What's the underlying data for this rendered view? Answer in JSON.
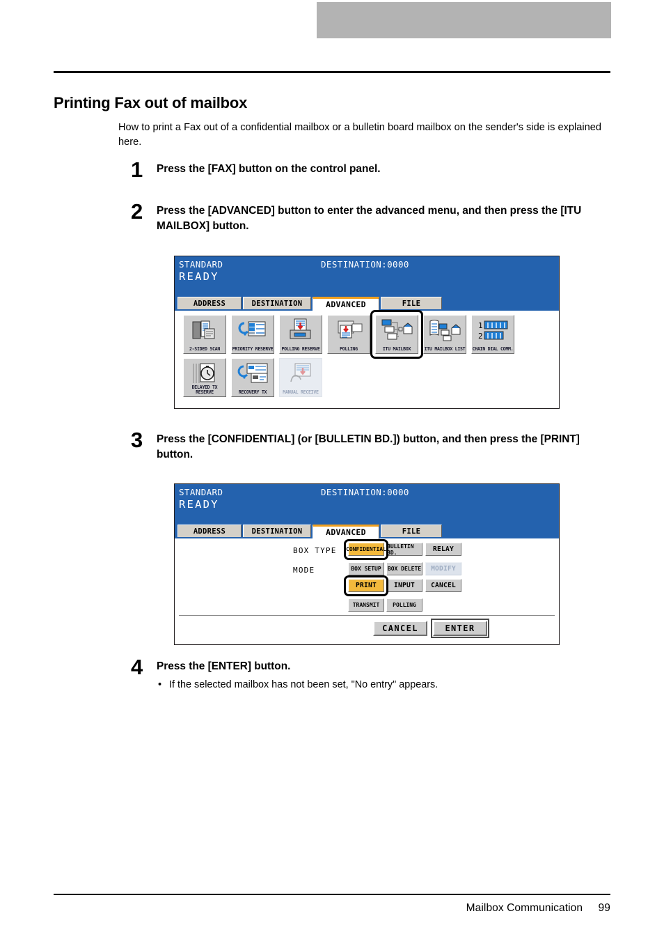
{
  "page": {
    "title": "Printing Fax out of mailbox",
    "intro": "How to print a Fax out of a confidential mailbox or a bulletin board mailbox on the sender's side is explained here.",
    "footer_section": "Mailbox Communication",
    "footer_page": "99"
  },
  "steps": [
    {
      "number": "1",
      "text": "Press the [FAX] button on the control panel."
    },
    {
      "number": "2",
      "text": "Press the [ADVANCED] button to enter the advanced menu, and then press the [ITU MAILBOX] button."
    },
    {
      "number": "3",
      "text": "Press the [CONFIDENTIAL] (or [BULLETIN BD.]) button, and then press the [PRINT] button."
    },
    {
      "number": "4",
      "text": "Press the [ENTER] button.",
      "bullet": "•",
      "note": "If the selected mailbox has not been set, \"No entry\" appears."
    }
  ],
  "panel_advanced": {
    "status_left": "STANDARD",
    "status_right": "DESTINATION:0000",
    "ready": "READY",
    "tabs": [
      {
        "label": "ADDRESS",
        "active": false
      },
      {
        "label": "DESTINATION",
        "active": false
      },
      {
        "label": "ADVANCED",
        "active": true
      },
      {
        "label": "FILE",
        "active": false
      }
    ],
    "row1": [
      {
        "label": "2-SIDED SCAN",
        "icon": "two-sided-scan-icon",
        "state": "normal"
      },
      {
        "label": "PRIORITY RESERVE",
        "icon": "priority-reserve-icon",
        "state": "normal"
      },
      {
        "label": "POLLING RESERVE",
        "icon": "polling-reserve-icon",
        "state": "normal"
      },
      {
        "label": "POLLING",
        "icon": "polling-icon",
        "state": "normal"
      },
      {
        "label": "ITU MAILBOX",
        "icon": "itu-mailbox-icon",
        "state": "highlighted"
      },
      {
        "label": "ITU MAILBOX LIST",
        "icon": "itu-mailbox-list-icon",
        "state": "normal"
      },
      {
        "label": "CHAIN DIAL COMM.",
        "icon": "chain-dial-comm-icon",
        "state": "normal"
      }
    ],
    "row2": [
      {
        "label": "DELAYED TX\nRESERVE",
        "icon": "delayed-tx-reserve-icon",
        "state": "normal"
      },
      {
        "label": "RECOVERY TX",
        "icon": "recovery-tx-icon",
        "state": "normal"
      },
      {
        "label": "MANUAL RECEIVE",
        "icon": "manual-receive-icon",
        "state": "disabled"
      }
    ]
  },
  "panel_mailbox": {
    "status_left": "STANDARD",
    "status_right": "DESTINATION:0000",
    "ready": "READY",
    "tabs": [
      {
        "label": "ADDRESS",
        "active": false
      },
      {
        "label": "DESTINATION",
        "active": false
      },
      {
        "label": "ADVANCED",
        "active": true
      },
      {
        "label": "FILE",
        "active": false
      }
    ],
    "label_box_type": "BOX TYPE",
    "label_mode": "MODE",
    "box_type_buttons": [
      {
        "label": "CONFIDENTIAL",
        "state": "selected"
      },
      {
        "label": "BULLETIN BD.",
        "state": "normal"
      },
      {
        "label": "RELAY",
        "state": "normal"
      }
    ],
    "mode_row1": [
      {
        "label": "BOX SETUP",
        "state": "normal"
      },
      {
        "label": "BOX DELETE",
        "state": "normal"
      },
      {
        "label": "MODIFY",
        "state": "disabled"
      }
    ],
    "mode_row2": [
      {
        "label": "PRINT",
        "state": "selected"
      },
      {
        "label": "INPUT",
        "state": "normal"
      },
      {
        "label": "CANCEL",
        "state": "normal"
      }
    ],
    "mode_row3": [
      {
        "label": "TRANSMIT",
        "state": "normal"
      },
      {
        "label": "POLLING",
        "state": "normal"
      }
    ],
    "footer_cancel": "CANCEL",
    "footer_enter": "ENTER"
  },
  "colors": {
    "lcd_blue": "#2462ae",
    "tab_accent": "#f0a020",
    "selected_button": "#f3b93c",
    "top_bar_gray": "#b3b3b3"
  }
}
